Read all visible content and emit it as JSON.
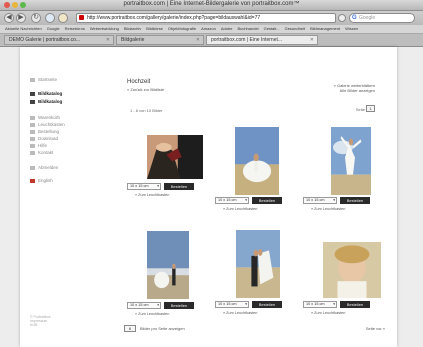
{
  "window": {
    "title": "portraitbox.com | Eine Internet-Bildergalerie von portraitbox.com™"
  },
  "toolbar": {
    "back_symbol": "◀",
    "forward_symbol": "▶",
    "reload_symbol": "↻",
    "url": "http://www.portraitbox.com/gallery/galerie/index.php?page=bildauswahl&id=77",
    "search_placeholder": "Google"
  },
  "bookmarks": [
    "Aktuelle Nachrichten",
    "Google",
    "Reisebüros",
    "Webentwicklung",
    "Bildarchiv",
    "Bildbörse",
    "Objektfotografie",
    "Amazon",
    "Adobe",
    "Buchhandel",
    "Gestalt...",
    "Gesundheit",
    "Bildmanagement",
    "Wissen"
  ],
  "tabs": [
    {
      "label": "DEMO Galerie | portraitbox.co...",
      "active": false
    },
    {
      "label": "Bildgalerie",
      "active": false
    },
    {
      "label": "portraitbox.com | Eine Internet...",
      "active": true
    }
  ],
  "sidebar": {
    "items": [
      {
        "label": "Startseite",
        "bold": false,
        "icon": "home-icon"
      },
      {
        "label": "Bildkatalog",
        "bold": true,
        "icon": "grid-icon"
      },
      {
        "label": "Bildkatalog",
        "bold": true,
        "icon": "grid-icon"
      },
      {
        "label": "Warenkorb",
        "bold": false,
        "icon": "cart-icon"
      },
      {
        "label": "Leuchtkasten",
        "bold": false,
        "icon": "lightbox-icon"
      },
      {
        "label": "Bestellung",
        "bold": false,
        "icon": "order-icon"
      },
      {
        "label": "Download",
        "bold": false,
        "icon": "download-icon"
      },
      {
        "label": "Hilfe",
        "bold": false,
        "icon": "help-icon"
      },
      {
        "label": "Kontakt",
        "bold": false,
        "icon": "contact-icon"
      },
      {
        "label": "Abmelden",
        "bold": false,
        "icon": "logout-icon"
      },
      {
        "label": "English",
        "bold": false,
        "icon": "flag-icon"
      }
    ],
    "footer": [
      "© Portraitbox",
      "Impressum",
      "AGB"
    ]
  },
  "main": {
    "title": "Hochzeit",
    "back_link": "« Zurück zur Bildliste",
    "top_link_line1": "» Galerie weiterblättern",
    "top_link_line2": "Alle Bilder anzeigen",
    "count_text": "1 - 6 von 10 Bilder",
    "page_label": "Seite",
    "page_value": "1",
    "bottom_select_value": "6",
    "bottom_label": "Bilder pro Seite anzeigen",
    "next_link": "Seite vor »"
  },
  "photos": [
    {
      "size": "10 x 15 cm",
      "order_label": "Bestellen",
      "lightbox_label": "» Zum Leuchtkasten",
      "subject": "groom-tie"
    },
    {
      "size": "10 x 15 cm",
      "order_label": "Bestellen",
      "lightbox_label": "» Zum Leuchtkasten",
      "subject": "bride-beach"
    },
    {
      "size": "10 x 15 cm",
      "order_label": "Bestellen",
      "lightbox_label": "» Zum Leuchtkasten",
      "subject": "bride-jumping"
    },
    {
      "size": "10 x 15 cm",
      "order_label": "Bestellen",
      "lightbox_label": "» Zum Leuchtkasten",
      "subject": "couple-shore"
    },
    {
      "size": "10 x 15 cm",
      "order_label": "Bestellen",
      "lightbox_label": "» Zum Leuchtkasten",
      "subject": "couple-kiss"
    },
    {
      "size": "10 x 15 cm",
      "order_label": "Bestellen",
      "lightbox_label": "» Zum Leuchtkasten",
      "subject": "bride-smiling"
    }
  ]
}
